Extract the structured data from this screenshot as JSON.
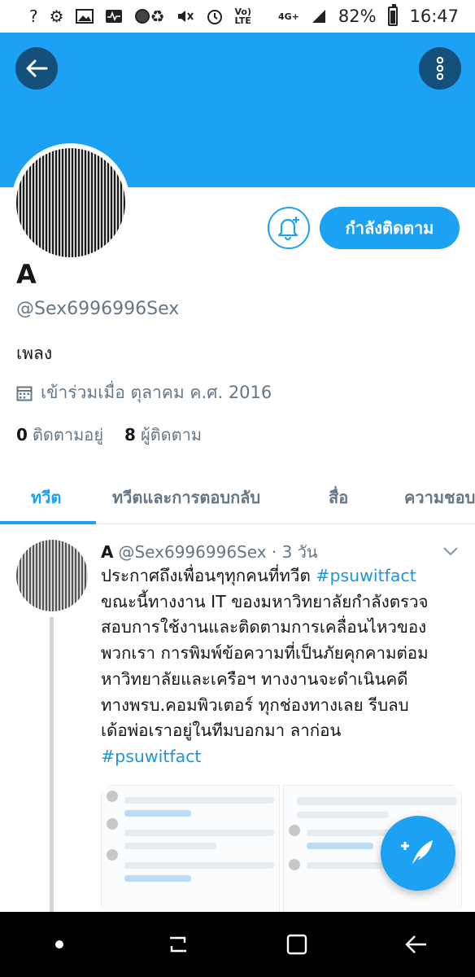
{
  "status_bar": {
    "left_icons": [
      "question-icon",
      "settings-icon",
      "image-icon",
      "activity-icon",
      "circle-icon"
    ],
    "right_icons": [
      "recycle-icon",
      "mute-icon",
      "alarm-icon"
    ],
    "volte": "Vo) LTE",
    "network": "4G+",
    "battery_percent": "82%",
    "time": "16:47"
  },
  "colors": {
    "accent": "#1da1f2",
    "header_button": "#14507a",
    "text": "#14171a",
    "secondary_text": "#657786"
  },
  "profile": {
    "follow_button_label": "กำลังติดตาม",
    "name": "A",
    "handle": "@Sex6996996Sex",
    "bio": "เพลง",
    "joined": "เข้าร่วมเมื่อ ตุลาคม ค.ศ. 2016",
    "following_count": "0",
    "following_label": "ติดตามอยู่",
    "followers_count": "8",
    "followers_label": "ผู้ติดตาม"
  },
  "tabs": [
    {
      "label": "ทวีต",
      "active": true
    },
    {
      "label": "ทวีตและการตอบกลับ",
      "active": false
    },
    {
      "label": "สื่อ",
      "active": false
    },
    {
      "label": "ความชอบ",
      "active": false
    }
  ],
  "tweet": {
    "author_name": "A",
    "author_handle": "@Sex6996996Sex",
    "time": "· 3 วัน",
    "lines": [
      {
        "text": "ประกาศถึงเพื่อนๆทุกคนที่ทวีต ",
        "hashtag": "#psuwitfact"
      },
      {
        "text": "ขณะนี้ทางงาน IT ของมหาวิทยาลัยกำลังตรวจ",
        "hashtag": ""
      },
      {
        "text": "สอบการใช้งานและติดตามการเคลื่อนไหวของ",
        "hashtag": ""
      },
      {
        "text": "พวกเรา การพิมพ์ข้อความที่เป็นภัยคุกคามต่อม",
        "hashtag": ""
      },
      {
        "text": "หาวิทยาลัยและเครือฯ ทางงานจะดำเนินคดี",
        "hashtag": ""
      },
      {
        "text": "ทางพรบ.คอมพิวเตอร์ ทุกช่องทางเลย รีบลบ",
        "hashtag": ""
      },
      {
        "text": "เด้อพ่อเราอยู่ในทีมบอกมา ลาก่อน",
        "hashtag": ""
      },
      {
        "text": "",
        "hashtag": "#psuwitfact"
      }
    ]
  }
}
